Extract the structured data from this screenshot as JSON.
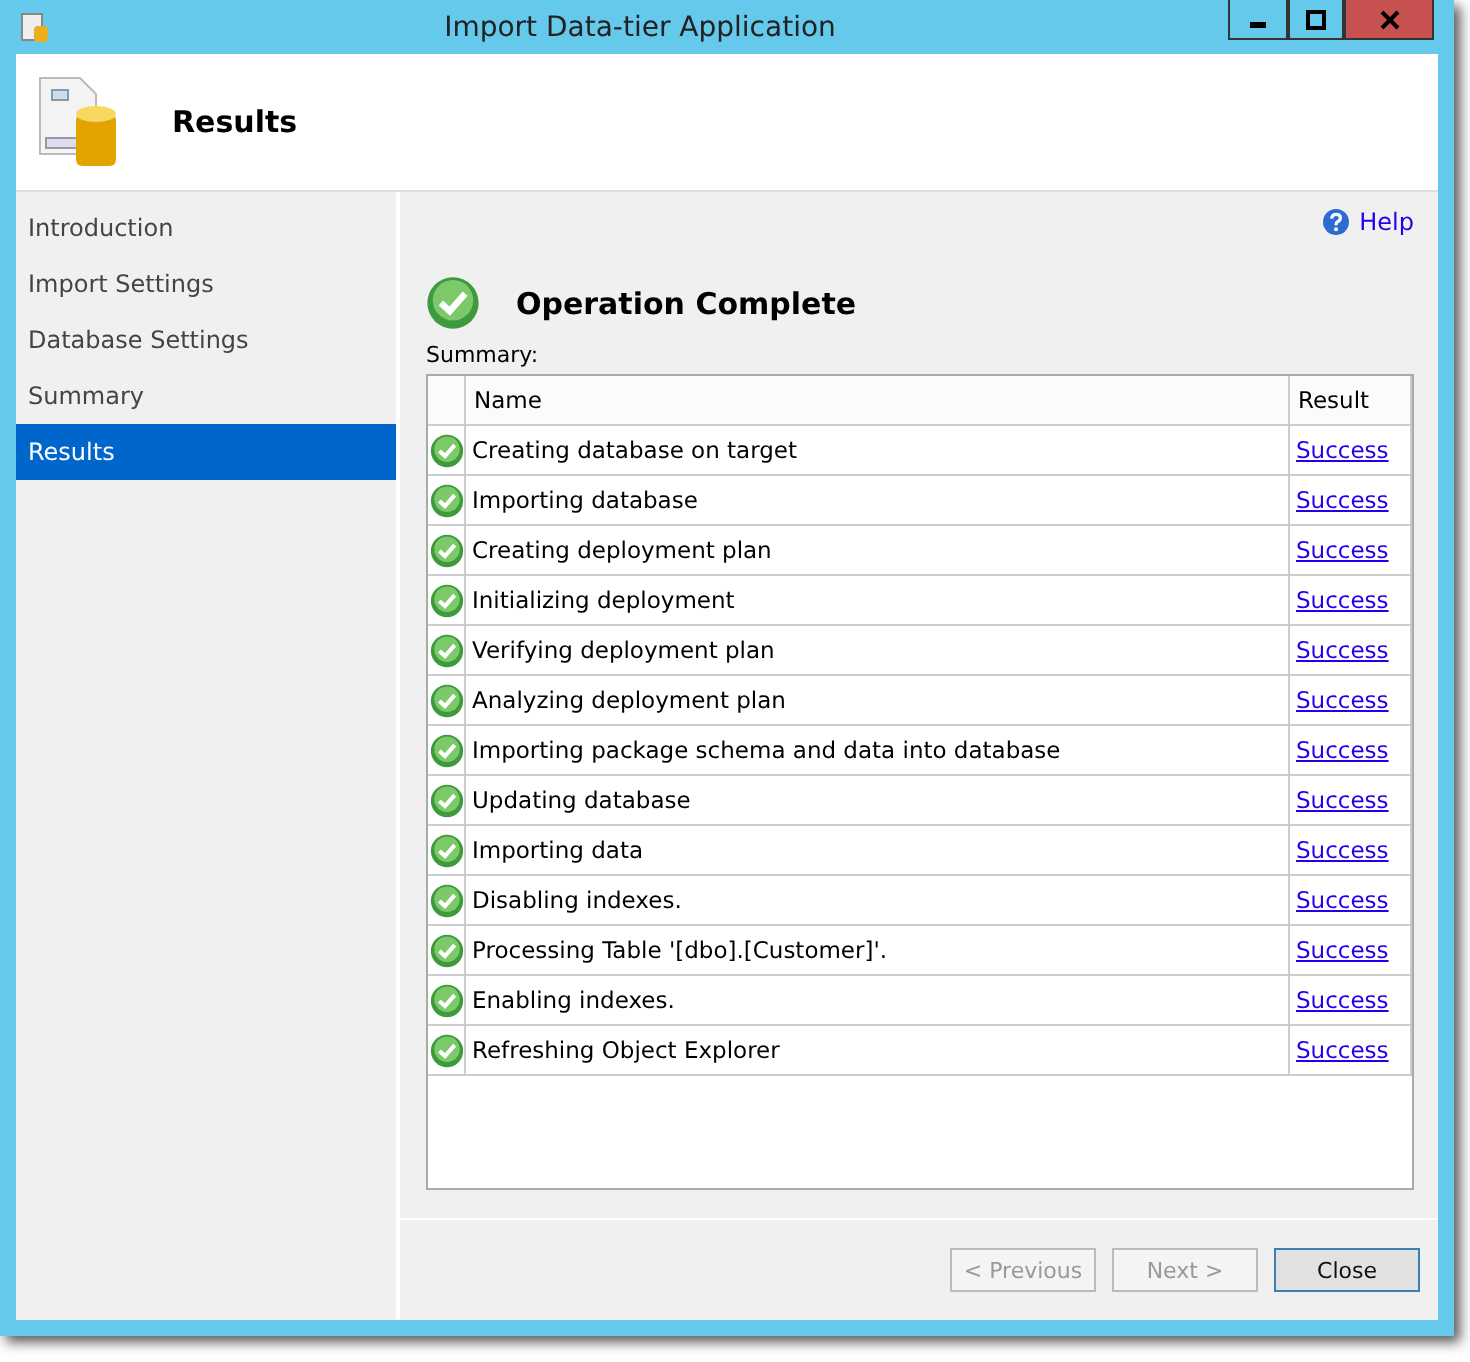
{
  "window": {
    "title": "Import Data-tier Application"
  },
  "header": {
    "title": "Results"
  },
  "sidebar": {
    "items": [
      {
        "label": "Introduction",
        "selected": false
      },
      {
        "label": "Import Settings",
        "selected": false
      },
      {
        "label": "Database Settings",
        "selected": false
      },
      {
        "label": "Summary",
        "selected": false
      },
      {
        "label": "Results",
        "selected": true
      }
    ]
  },
  "help": "Help",
  "status": "Operation Complete",
  "summary_label": "Summary:",
  "table": {
    "columns": [
      "Name",
      "Result"
    ],
    "rows": [
      {
        "name": "Creating database on target",
        "result": "Success"
      },
      {
        "name": "Importing database",
        "result": "Success"
      },
      {
        "name": "Creating deployment plan",
        "result": "Success"
      },
      {
        "name": "Initializing deployment",
        "result": "Success"
      },
      {
        "name": "Verifying deployment plan",
        "result": "Success"
      },
      {
        "name": "Analyzing deployment plan",
        "result": "Success"
      },
      {
        "name": "Importing package schema and data into database",
        "result": "Success"
      },
      {
        "name": "Updating database",
        "result": "Success"
      },
      {
        "name": "Importing data",
        "result": "Success"
      },
      {
        "name": "Disabling indexes.",
        "result": "Success"
      },
      {
        "name": "Processing Table '[dbo].[Customer]'.",
        "result": "Success"
      },
      {
        "name": "Enabling indexes.",
        "result": "Success"
      },
      {
        "name": "Refreshing Object Explorer",
        "result": "Success"
      }
    ]
  },
  "buttons": [
    {
      "label": "< Previous",
      "disabled": true
    },
    {
      "label": "Next >",
      "disabled": true
    },
    {
      "label": "Close",
      "disabled": false
    }
  ]
}
